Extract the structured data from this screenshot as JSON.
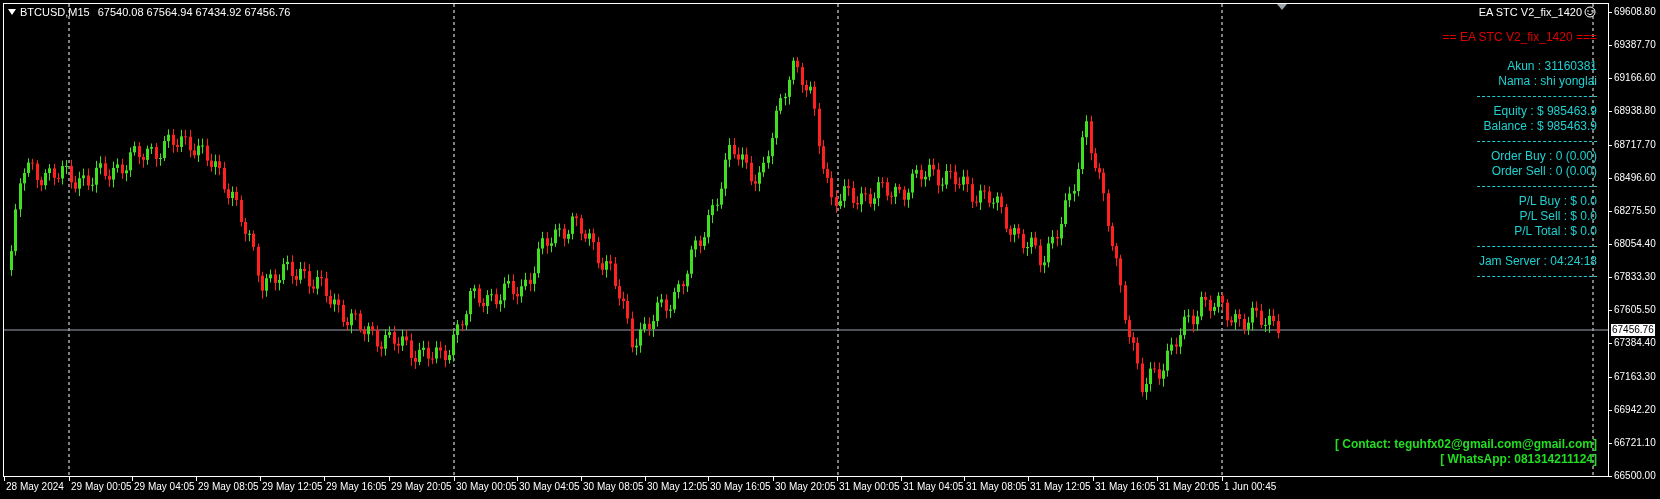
{
  "chart_header": {
    "symbol": "BTCUSD,M15",
    "quote": "67540.08 67564.94 67434.92 67456.76"
  },
  "expert": {
    "name": "EA STC V2_fix_1420"
  },
  "panel": [
    {
      "kind": "title",
      "text": "== EA STC V2_fix_1420 ==="
    },
    {
      "kind": "info",
      "text": "Akun : 31160381"
    },
    {
      "kind": "info",
      "text": "Nama : shi yonglai"
    },
    {
      "kind": "divider"
    },
    {
      "kind": "info",
      "text": "Equity : $ 985463.9"
    },
    {
      "kind": "info",
      "text": "Balance : $ 985463.9"
    },
    {
      "kind": "divider"
    },
    {
      "kind": "info",
      "text": "Order Buy : 0 (0.00)"
    },
    {
      "kind": "info",
      "text": "Order Sell : 0 (0.00)"
    },
    {
      "kind": "divider"
    },
    {
      "kind": "info",
      "text": "P/L Buy : $ 0.0"
    },
    {
      "kind": "info",
      "text": "P/L Sell : $ 0.0"
    },
    {
      "kind": "info",
      "text": "P/L Total : $ 0.0"
    },
    {
      "kind": "divider"
    },
    {
      "kind": "info",
      "text": "Jam Server : 04:24:18"
    },
    {
      "kind": "divider"
    }
  ],
  "contact": [
    "[ Contact:  teguhfx02@gmail.com@gmail.com]",
    "[ WhatsApp:  081314211124]"
  ],
  "price_axis": [
    "69608.80",
    "69387.70",
    "69166.60",
    "68938.80",
    "68717.70",
    "68496.60",
    "68275.50",
    "68054.40",
    "67833.30",
    "67605.50",
    "67384.40",
    "67163.30",
    "66942.20",
    "66721.10",
    "66500.00"
  ],
  "current_price": "67456.76",
  "time_axis": [
    "28 May 2024",
    "29 May 00:05",
    "29 May 04:05",
    "29 May 08:05",
    "29 May 12:05",
    "29 May 16:05",
    "29 May 20:05",
    "30 May 00:05",
    "30 May 04:05",
    "30 May 08:05",
    "30 May 12:05",
    "30 May 16:05",
    "30 May 20:05",
    "31 May 00:05",
    "31 May 04:05",
    "31 May 08:05",
    "31 May 12:05",
    "31 May 16:05",
    "31 May 20:05",
    "1 Jun 00:45"
  ]
}
